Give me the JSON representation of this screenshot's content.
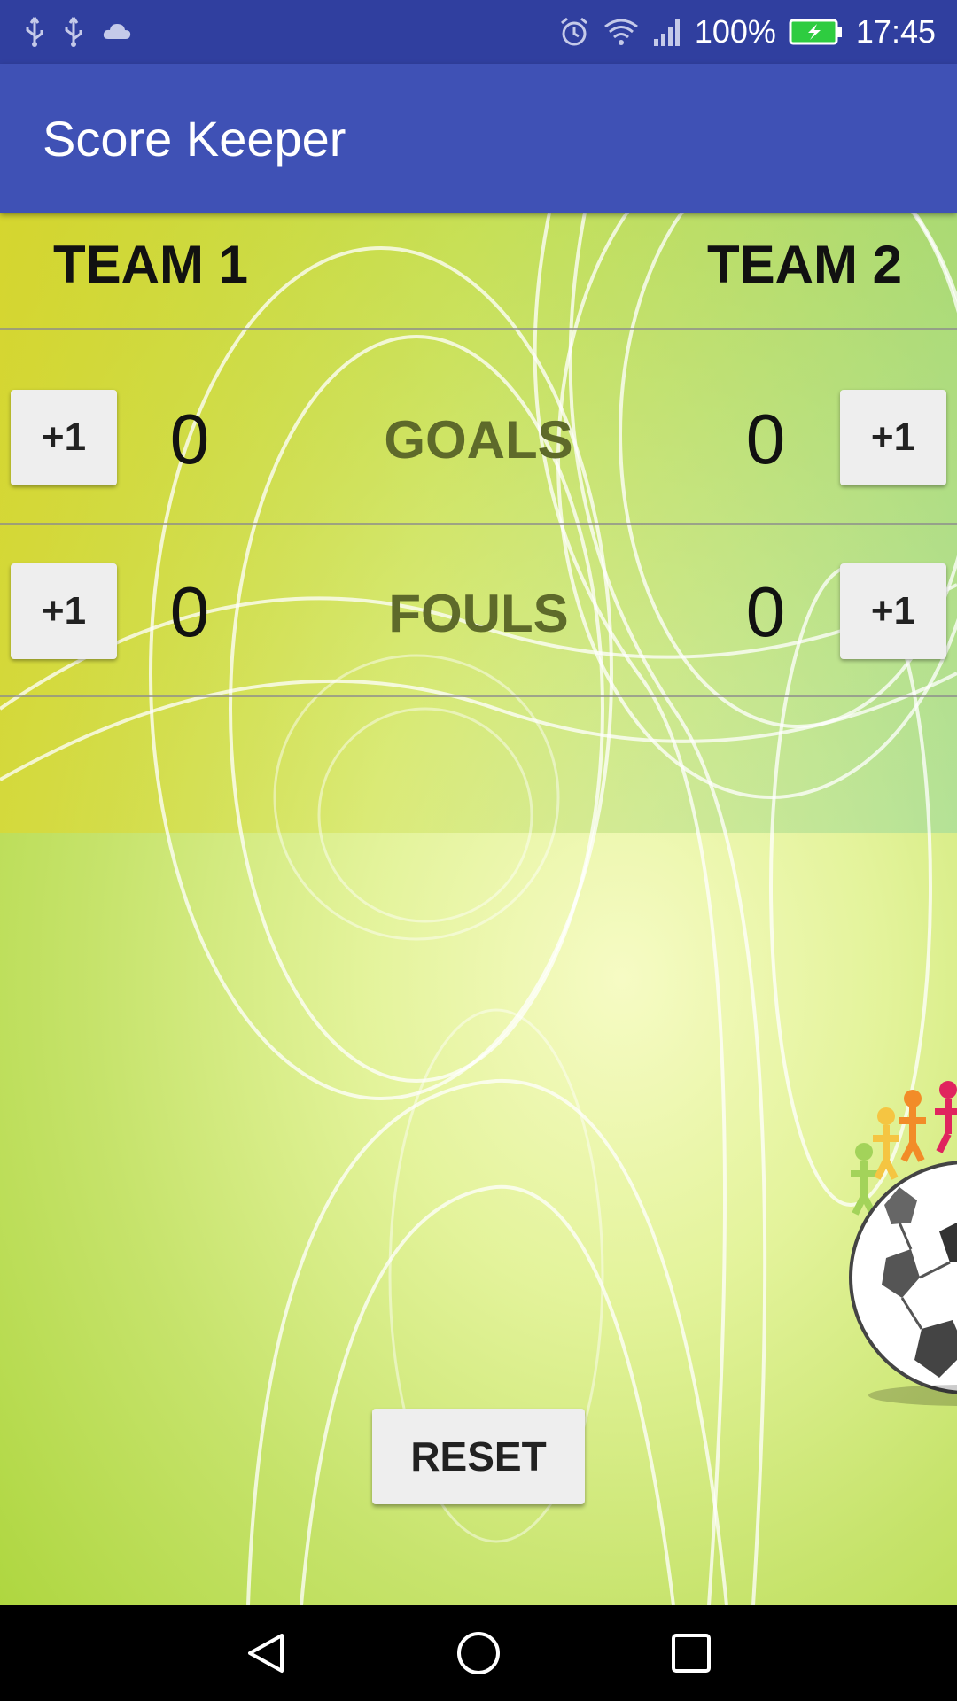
{
  "status_bar": {
    "left_icons": [
      "usb-icon",
      "usb-icon",
      "cloud-icon"
    ],
    "right_icons": [
      "alarm-icon",
      "wifi-icon",
      "signal-icon"
    ],
    "battery_percent": "100%",
    "battery_icon": "battery-charging-icon",
    "time": "17:45"
  },
  "app_bar": {
    "title": "Score Keeper",
    "color": "#3F51B5"
  },
  "teams": {
    "team1": "TEAM 1",
    "team2": "TEAM 2"
  },
  "goals": {
    "label": "GOALS",
    "team1_score": "0",
    "team2_score": "0",
    "team1_button": "+1",
    "team2_button": "+1"
  },
  "fouls": {
    "label": "FOULS",
    "team1_score": "0",
    "team2_score": "0",
    "team1_button": "+1",
    "team2_button": "+1"
  },
  "reset": {
    "label": "RESET"
  },
  "nav_bar": {
    "icons": [
      "back-icon",
      "home-icon",
      "recents-icon"
    ]
  }
}
